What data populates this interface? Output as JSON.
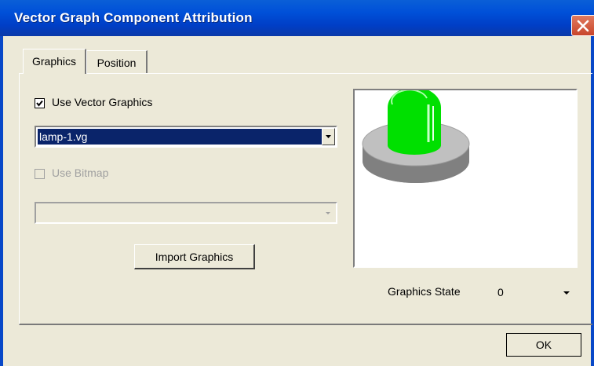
{
  "window": {
    "title": "Vector Graph Component Attribution"
  },
  "tabs": [
    {
      "label": "Graphics"
    },
    {
      "label": "Position"
    }
  ],
  "graphics": {
    "use_vector_label": "Use Vector Graphics",
    "use_vector_checked": true,
    "vector_file": "lamp-1.vg",
    "use_bitmap_label": "Use Bitmap",
    "use_bitmap_checked": false,
    "bitmap_file": "",
    "import_label": "Import Graphics"
  },
  "preview": {
    "icon": "green-lamp-icon",
    "lamp_color": "#00e000",
    "base_color": "#c0c0c0"
  },
  "state": {
    "label": "Graphics State",
    "value": "0"
  },
  "footer": {
    "ok_label": "OK"
  }
}
